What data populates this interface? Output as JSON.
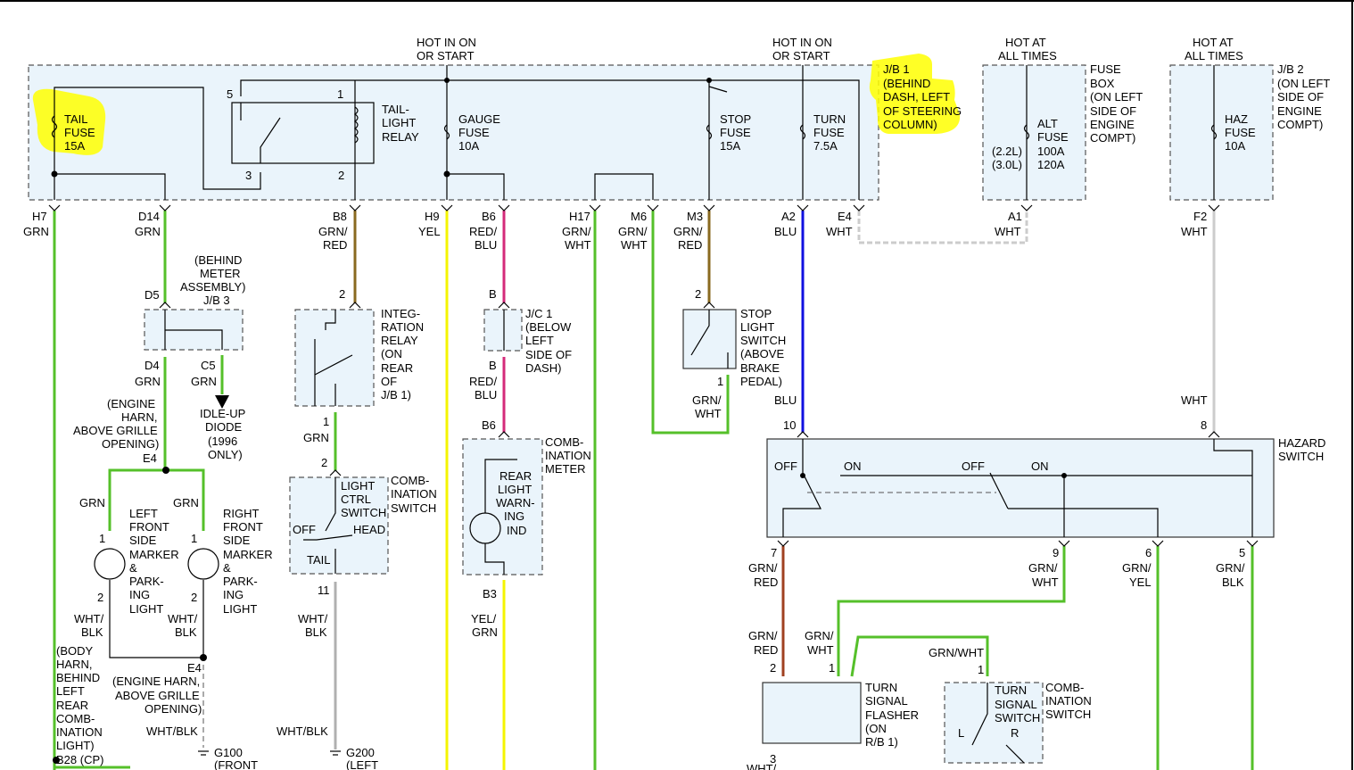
{
  "colors": {
    "highlight": "#ffff00",
    "green": "#55c02a",
    "yellow": "#f4f400",
    "pink": "#d42a7a",
    "blue": "#1010e0",
    "olive": "#8a6a20",
    "gray": "#b0b0b0",
    "redbrown": "#a04020",
    "box_fill": "#eaf4fb"
  },
  "hot_labels": {
    "hot_run_1": [
      "HOT IN ON",
      "OR START"
    ],
    "hot_run_2": [
      "HOT IN ON",
      "OR START"
    ],
    "hot_all_1": [
      "HOT AT",
      "ALL TIMES"
    ],
    "hot_all_2": [
      "HOT AT",
      "ALL TIMES"
    ]
  },
  "blocks": {
    "jb1": [
      "J/B 1",
      "(BEHIND",
      "DASH, LEFT",
      "OF STEERING",
      "COLUMN)"
    ],
    "fuse_box": [
      "FUSE",
      "BOX",
      "(ON LEFT",
      "SIDE OF",
      "ENGINE",
      "COMPT)"
    ],
    "jb2": [
      "J/B 2",
      "(ON LEFT",
      "SIDE OF",
      "ENGINE",
      "COMPT)"
    ]
  },
  "fuses": {
    "tail": [
      "TAIL",
      "FUSE",
      "15A"
    ],
    "gauge": [
      "GAUGE",
      "FUSE",
      "10A"
    ],
    "stop": [
      "STOP",
      "FUSE",
      "15A"
    ],
    "turn": [
      "TURN",
      "FUSE",
      "7.5A"
    ],
    "alt": [
      "ALT",
      "FUSE",
      "100A",
      "120A"
    ],
    "alt_engine": [
      "(2.2L)",
      "(3.0L)"
    ],
    "haz": [
      "HAZ",
      "FUSE",
      "10A"
    ]
  },
  "relay": {
    "label": [
      "TAIL-",
      "LIGHT",
      "RELAY"
    ],
    "pin5": "5",
    "pin1": "1",
    "pin3": "3",
    "pin2": "2"
  },
  "connectors": [
    {
      "id": "h7",
      "pin": "H7",
      "wire": [
        "GRN"
      ]
    },
    {
      "id": "d14",
      "pin": "D14",
      "wire": [
        "GRN"
      ]
    },
    {
      "id": "b8",
      "pin": "B8",
      "wire": [
        "GRN/",
        "RED"
      ]
    },
    {
      "id": "h9",
      "pin": "H9",
      "wire": [
        "YEL"
      ]
    },
    {
      "id": "b6",
      "pin": "B6",
      "wire": [
        "RED/",
        "BLU"
      ]
    },
    {
      "id": "h17",
      "pin": "H17",
      "wire": [
        "GRN/",
        "WHT"
      ]
    },
    {
      "id": "m6",
      "pin": "M6",
      "wire": [
        "GRN/",
        "WHT"
      ]
    },
    {
      "id": "m3",
      "pin": "M3",
      "wire": [
        "GRN/",
        "RED"
      ]
    },
    {
      "id": "a2",
      "pin": "A2",
      "wire": [
        "BLU"
      ]
    },
    {
      "id": "e4",
      "pin": "E4",
      "wire": [
        "WHT"
      ]
    },
    {
      "id": "a1",
      "pin": "A1",
      "wire": [
        "WHT"
      ]
    },
    {
      "id": "f2",
      "pin": "F2",
      "wire": [
        "WHT"
      ]
    }
  ],
  "jb3": {
    "label": [
      "(BEHIND",
      "METER",
      "ASSEMBLY)",
      "J/B 3"
    ],
    "d5": "D5",
    "d4": "D4",
    "c5": "C5",
    "wire_d4": "GRN",
    "wire_c5": "GRN",
    "idle": [
      "IDLE-UP",
      "DIODE",
      "(1996",
      "ONLY)"
    ]
  },
  "engine_harn_top": [
    "(ENGINE",
    "HARN,",
    "ABOVE GRILLE",
    "OPENING)"
  ],
  "e4_top": "E4",
  "left_marker": {
    "wire_in": "GRN",
    "label": [
      "LEFT",
      "FRONT",
      "SIDE",
      "MARKER",
      "&",
      "PARK-",
      "ING",
      "LIGHT"
    ],
    "pin1": "1",
    "pin2": "2",
    "wire_out": [
      "WHT/",
      "BLK"
    ]
  },
  "right_marker": {
    "wire_in": "GRN",
    "label": [
      "RIGHT",
      "FRONT",
      "SIDE",
      "MARKER",
      "&",
      "PARK-",
      "ING",
      "LIGHT"
    ],
    "pin1": "1",
    "pin2": "2",
    "wire_out": [
      "WHT/",
      "BLK"
    ]
  },
  "body_harn": [
    "(BODY",
    "HARN,",
    "BEHIND",
    "LEFT",
    "REAR",
    "COMB-",
    "INATION",
    "LIGHT)"
  ],
  "b28": "B28 (CP)",
  "engine_harn_bottom": {
    "pin": "E4",
    "label": [
      "(ENGINE HARN,",
      "ABOVE GRILLE",
      "OPENING)"
    ],
    "wire": "WHT/BLK"
  },
  "g100": [
    "G100",
    "(FRONT"
  ],
  "integration_relay": {
    "label": [
      "INTEG-",
      "RATION",
      "RELAY",
      "(ON",
      "REAR",
      "OF",
      "J/B 1)"
    ],
    "pin_top": "2",
    "pin_bottom": "1",
    "wire_out": "GRN"
  },
  "light_switch": {
    "pin_top": "2",
    "label": [
      "LIGHT",
      "CTRL",
      "SWITCH"
    ],
    "off": "OFF",
    "head": "HEAD",
    "tail": "TAIL",
    "comb": [
      "COMB-",
      "INATION",
      "SWITCH"
    ],
    "pin_bottom": "11",
    "wire_out": [
      "WHT/",
      "BLK"
    ],
    "wire_ground": "WHT/BLK"
  },
  "g200": [
    "G200",
    "(LEFT"
  ],
  "jc1": {
    "b_top": "B",
    "b_bottom": "B",
    "label": [
      "J/C 1",
      "(BELOW",
      "LEFT",
      "SIDE OF",
      "DASH)"
    ],
    "wire_out": [
      "RED/",
      "BLU"
    ]
  },
  "comb_meter": {
    "pin_top": "B6",
    "label": [
      "COMB-",
      "INATION",
      "METER"
    ],
    "ind": [
      "REAR",
      "LIGHT",
      "WARN-",
      "ING",
      "IND"
    ],
    "pin_bottom": "B3",
    "wire_out": [
      "YEL/",
      "GRN"
    ]
  },
  "stop_switch": {
    "pin_top": "2",
    "pin_bottom": "1",
    "label": [
      "STOP",
      "LIGHT",
      "SWITCH",
      "(ABOVE",
      "BRAKE",
      "PEDAL)"
    ],
    "wire_out": [
      "GRN/",
      "WHT"
    ]
  },
  "hazard": {
    "label": [
      "HAZARD",
      "SWITCH"
    ],
    "blu": "BLU",
    "wht": "WHT",
    "pin10": "10",
    "pin8": "8",
    "off1": "OFF",
    "on1": "ON",
    "off2": "OFF",
    "on2": "ON",
    "pin7": "7",
    "pin9": "9",
    "pin6": "6",
    "pin5": "5",
    "w7": [
      "GRN/",
      "RED"
    ],
    "w9": [
      "GRN/",
      "WHT"
    ],
    "w6": [
      "GRN/",
      "YEL"
    ],
    "w5": [
      "GRN/",
      "BLK"
    ]
  },
  "flasher": {
    "w_red": [
      "GRN/",
      "RED"
    ],
    "w_wht": [
      "GRN/",
      "WHT"
    ],
    "pin2": "2",
    "pin1": "1",
    "pin3": "3",
    "label": [
      "TURN",
      "SIGNAL",
      "FLASHER",
      "(ON",
      "R/B 1)"
    ],
    "wht_cut": "WHT/"
  },
  "turn_switch": {
    "wire": "GRN/WHT",
    "pin1": "1",
    "label": [
      "TURN",
      "SIGNAL",
      "SWITCH"
    ],
    "comb": [
      "COMB-",
      "INATION",
      "SWITCH"
    ],
    "l": "L",
    "r": "R"
  }
}
